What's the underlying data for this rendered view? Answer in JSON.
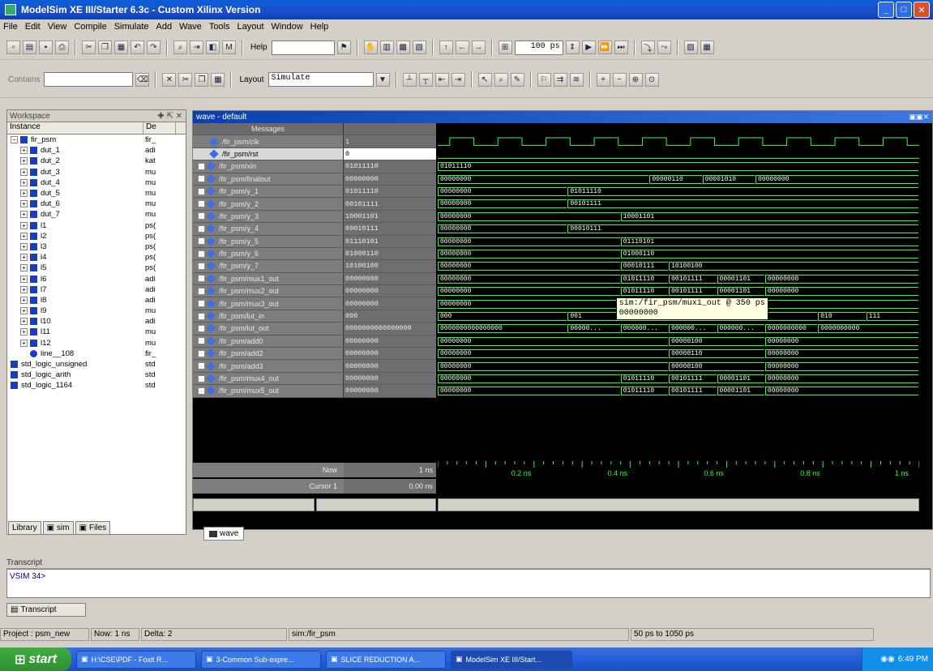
{
  "window": {
    "title": "ModelSim XE III/Starter 6.3c - Custom Xilinx Version"
  },
  "menu": [
    "File",
    "Edit",
    "View",
    "Compile",
    "Simulate",
    "Add",
    "Wave",
    "Tools",
    "Layout",
    "Window",
    "Help"
  ],
  "toolbar": {
    "help_label": "Help",
    "run_length": "100 ps",
    "contains_label": "Contains",
    "layout_label": "Layout",
    "layout_value": "Simulate"
  },
  "workspace": {
    "title": "Workspace",
    "col_instance": "Instance",
    "col_design": "De",
    "items": [
      {
        "name": "fir_psm",
        "desc": "fir_",
        "indent": 0,
        "expanded": true
      },
      {
        "name": "dut_1",
        "desc": "adi",
        "indent": 1
      },
      {
        "name": "dut_2",
        "desc": "kat",
        "indent": 1
      },
      {
        "name": "dut_3",
        "desc": "mu",
        "indent": 1
      },
      {
        "name": "dut_4",
        "desc": "mu",
        "indent": 1
      },
      {
        "name": "dut_5",
        "desc": "mu",
        "indent": 1
      },
      {
        "name": "dut_6",
        "desc": "mu",
        "indent": 1
      },
      {
        "name": "dut_7",
        "desc": "mu",
        "indent": 1
      },
      {
        "name": "l1",
        "desc": "ps(",
        "indent": 1
      },
      {
        "name": "l2",
        "desc": "ps(",
        "indent": 1
      },
      {
        "name": "l3",
        "desc": "ps(",
        "indent": 1
      },
      {
        "name": "l4",
        "desc": "ps(",
        "indent": 1
      },
      {
        "name": "l5",
        "desc": "ps(",
        "indent": 1
      },
      {
        "name": "l6",
        "desc": "adi",
        "indent": 1
      },
      {
        "name": "l7",
        "desc": "adi",
        "indent": 1
      },
      {
        "name": "l8",
        "desc": "adi",
        "indent": 1
      },
      {
        "name": "l9",
        "desc": "mu",
        "indent": 1
      },
      {
        "name": "l10",
        "desc": "adi",
        "indent": 1
      },
      {
        "name": "l11",
        "desc": "mu",
        "indent": 1
      },
      {
        "name": "l12",
        "desc": "mu",
        "indent": 1
      },
      {
        "name": "line__108",
        "desc": "fir_",
        "indent": 1,
        "process": true
      },
      {
        "name": "std_logic_unsigned",
        "desc": "std",
        "indent": 0
      },
      {
        "name": "std_logic_arith",
        "desc": "std",
        "indent": 0
      },
      {
        "name": "std_logic_1164",
        "desc": "std",
        "indent": 0
      }
    ],
    "tabs": [
      "Library",
      "sim",
      "Files"
    ]
  },
  "wave": {
    "title": "wave - default",
    "messages_header": "Messages",
    "signals": [
      {
        "name": "/fir_psm/clk",
        "value": "1",
        "kind": "clk"
      },
      {
        "name": "/fir_psm/rst",
        "value": "0",
        "kind": "low",
        "selected": true
      },
      {
        "name": "/fir_psm/xin",
        "value": "01011110"
      },
      {
        "name": "/fir_psm/finalout",
        "value": "00000000"
      },
      {
        "name": "/fir_psm/y_1",
        "value": "01011110"
      },
      {
        "name": "/fir_psm/y_2",
        "value": "00101111"
      },
      {
        "name": "/fir_psm/y_3",
        "value": "10001101"
      },
      {
        "name": "/fir_psm/y_4",
        "value": "00010111"
      },
      {
        "name": "/fir_psm/y_5",
        "value": "01110101"
      },
      {
        "name": "/fir_psm/y_6",
        "value": "01000110"
      },
      {
        "name": "/fir_psm/y_7",
        "value": "10100100"
      },
      {
        "name": "/fir_psm/mux1_out",
        "value": "00000000"
      },
      {
        "name": "/fir_psm/mux2_out",
        "value": "00000000"
      },
      {
        "name": "/fir_psm/mux3_out",
        "value": "00000000"
      },
      {
        "name": "/fir_psm/lut_in",
        "value": "000"
      },
      {
        "name": "/fir_psm/lut_out",
        "value": "0000000000000000"
      },
      {
        "name": "/fir_psm/add0",
        "value": "00000000"
      },
      {
        "name": "/fir_psm/add2",
        "value": "00000000"
      },
      {
        "name": "/fir_psm/add3",
        "value": "00000000"
      },
      {
        "name": "/fir_psm/mux4_out",
        "value": "00000000"
      },
      {
        "name": "/fir_psm/mux5_out",
        "value": "00000000"
      }
    ],
    "bus_segments": [
      null,
      null,
      [
        {
          "t": 0,
          "l": "01011110"
        }
      ],
      [
        {
          "t": 0,
          "l": "00000000"
        },
        {
          "t": 0.44,
          "l": "00000110"
        },
        {
          "t": 0.55,
          "l": "00001010"
        },
        {
          "t": 0.66,
          "l": "00000000"
        }
      ],
      [
        {
          "t": 0,
          "l": "00000000"
        },
        {
          "t": 0.27,
          "l": "01011110"
        }
      ],
      [
        {
          "t": 0,
          "l": "00000000"
        },
        {
          "t": 0.27,
          "l": "00101111"
        }
      ],
      [
        {
          "t": 0,
          "l": "00000000"
        },
        {
          "t": 0.38,
          "l": "10001101"
        }
      ],
      [
        {
          "t": 0,
          "l": "00000000"
        },
        {
          "t": 0.27,
          "l": "00010111"
        }
      ],
      [
        {
          "t": 0,
          "l": "00000000"
        },
        {
          "t": 0.38,
          "l": "01110101"
        }
      ],
      [
        {
          "t": 0,
          "l": "00000000"
        },
        {
          "t": 0.38,
          "l": "01000110"
        }
      ],
      [
        {
          "t": 0,
          "l": "00000000"
        },
        {
          "t": 0.38,
          "l": "00010111"
        },
        {
          "t": 0.48,
          "l": "10100100"
        }
      ],
      [
        {
          "t": 0,
          "l": "00000000"
        },
        {
          "t": 0.38,
          "l": "01011110"
        },
        {
          "t": 0.48,
          "l": "00101111"
        },
        {
          "t": 0.58,
          "l": "00001101"
        },
        {
          "t": 0.68,
          "l": "00000000"
        }
      ],
      [
        {
          "t": 0,
          "l": "00000000"
        },
        {
          "t": 0.38,
          "l": "01011110"
        },
        {
          "t": 0.48,
          "l": "00101111"
        },
        {
          "t": 0.58,
          "l": "00001101"
        },
        {
          "t": 0.68,
          "l": "00000000"
        }
      ],
      [
        {
          "t": 0,
          "l": "00000000"
        }
      ],
      [
        {
          "t": 0,
          "l": "000"
        },
        {
          "t": 0.27,
          "l": "001"
        },
        {
          "t": 0.79,
          "l": "010"
        },
        {
          "t": 0.89,
          "l": "111"
        }
      ],
      [
        {
          "t": 0,
          "l": "0000000000000000"
        },
        {
          "t": 0.27,
          "l": "00000..."
        },
        {
          "t": 0.38,
          "l": "000000..."
        },
        {
          "t": 0.48,
          "l": "000000..."
        },
        {
          "t": 0.58,
          "l": "000000..."
        },
        {
          "t": 0.68,
          "l": "0000000000"
        },
        {
          "t": 0.79,
          "l": "0000000000"
        }
      ],
      [
        {
          "t": 0,
          "l": "00000000"
        },
        {
          "t": 0.48,
          "l": "00000100"
        },
        {
          "t": 0.68,
          "l": "00000000"
        }
      ],
      [
        {
          "t": 0,
          "l": "00000000"
        },
        {
          "t": 0.48,
          "l": "00000110"
        },
        {
          "t": 0.68,
          "l": "00000000"
        }
      ],
      [
        {
          "t": 0,
          "l": "00000000"
        },
        {
          "t": 0.48,
          "l": "00000100"
        },
        {
          "t": 0.68,
          "l": "00000000"
        }
      ],
      [
        {
          "t": 0,
          "l": "00000000"
        },
        {
          "t": 0.38,
          "l": "01011110"
        },
        {
          "t": 0.48,
          "l": "00101111"
        },
        {
          "t": 0.58,
          "l": "00001101"
        },
        {
          "t": 0.68,
          "l": "00000000"
        }
      ],
      [
        {
          "t": 0,
          "l": "00000000"
        },
        {
          "t": 0.38,
          "l": "01011110"
        },
        {
          "t": 0.48,
          "l": "00101111"
        },
        {
          "t": 0.58,
          "l": "00001101"
        },
        {
          "t": 0.68,
          "l": "00000000"
        }
      ]
    ],
    "tooltip_line1": "sim:/fir_psm/mux1_out @ 350 ps",
    "tooltip_line2": "00000000",
    "now_label": "Now",
    "now_value": "1 ns",
    "cursor_label": "Cursor 1",
    "cursor_value": "0.00 ns",
    "time_ticks": [
      "0.2 ns",
      "0.4 ns",
      "0.6 ns",
      "0.8 ns",
      "1 ns"
    ],
    "tab_label": "wave"
  },
  "transcript": {
    "title": "Transcript",
    "prompt": "VSIM 34>",
    "tab_label": "Transcript"
  },
  "status": {
    "project": "Project : psm_new",
    "now": "Now: 1 ns",
    "delta": "Delta: 2",
    "context": "sim:/fir_psm",
    "range": "50 ps to 1050 ps"
  },
  "taskbar": {
    "start": "start",
    "tasks": [
      "H:\\CSE\\PDF - Foxit R...",
      "3-Common Sub-expre...",
      "SLICE REDUCTION A...",
      "ModelSim XE III/Start..."
    ],
    "clock": "6:49 PM"
  },
  "colors": {
    "wave_green": "#33ff33",
    "accent": "#1b4fc9"
  }
}
